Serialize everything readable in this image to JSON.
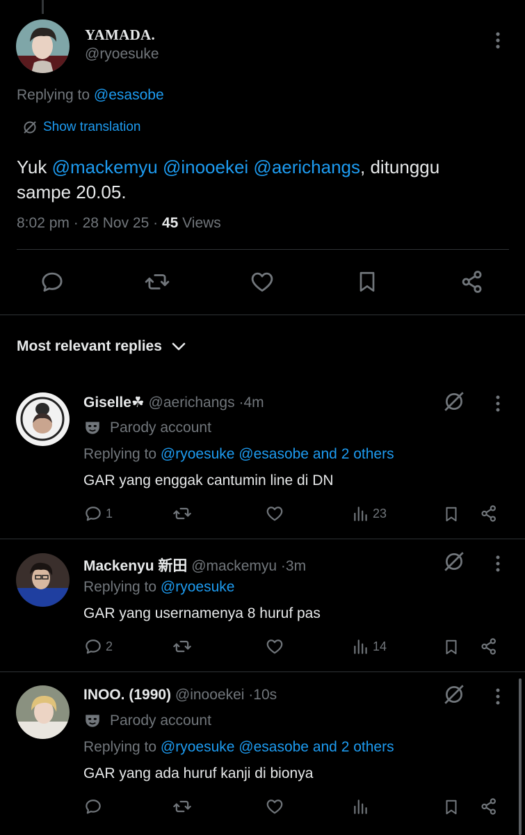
{
  "main_tweet": {
    "display_name": "YAMADA.",
    "handle": "@ryoesuke",
    "replying_prefix": "Replying to",
    "replying_to": "@esasobe",
    "show_translation": "Show translation",
    "text_prefix": "Yuk",
    "mention_1": "@mackemyu",
    "mention_2": "@inooekei",
    "mention_3": "@aerichangs",
    "text_suffix": ", ditunggu",
    "text_line2": "sampe 20.05.",
    "time": "8:02 pm",
    "date": "28 Nov 25",
    "views_count": "45",
    "views_label": "Views",
    "actions": [
      "reply-icon",
      "retweet-icon",
      "like-icon",
      "bookmark-icon",
      "share-icon"
    ]
  },
  "sort": {
    "label": "Most relevant replies",
    "icon": "chevron-down-icon"
  },
  "replies": [
    {
      "display_name": "Giselle☘",
      "handle": "@aerichangs",
      "time": "4m",
      "parody_label": "Parody account",
      "replying_prefix": "Replying to",
      "replying_to": "@ryoesuke @esasobe and 2 others",
      "text": "GAR yang enggak cantumin line di DN",
      "reply_count": "1",
      "retweet_count": "",
      "like_count": "",
      "views": "23"
    },
    {
      "display_name": "Mackenyu 新田",
      "handle": "@mackemyu",
      "time": "3m",
      "replying_prefix": "Replying to",
      "replying_to": "@ryoesuke",
      "text": "GAR yang usernamenya 8 huruf pas",
      "reply_count": "2",
      "retweet_count": "",
      "like_count": "",
      "views": "14"
    },
    {
      "display_name": "INOO. (1990)",
      "handle": "@inooekei",
      "time": "10s",
      "parody_label": "Parody account",
      "replying_prefix": "Replying to",
      "replying_to": "@ryoesuke @esasobe and 2 others",
      "text": "GAR yang ada huruf kanji di bionya",
      "reply_count": "",
      "retweet_count": "",
      "like_count": "",
      "views": ""
    }
  ],
  "colors": {
    "background": "#000000",
    "text": "#e7e9ea",
    "secondary": "#71767b",
    "accent": "#1d9bf0",
    "divider": "#2f3336"
  }
}
